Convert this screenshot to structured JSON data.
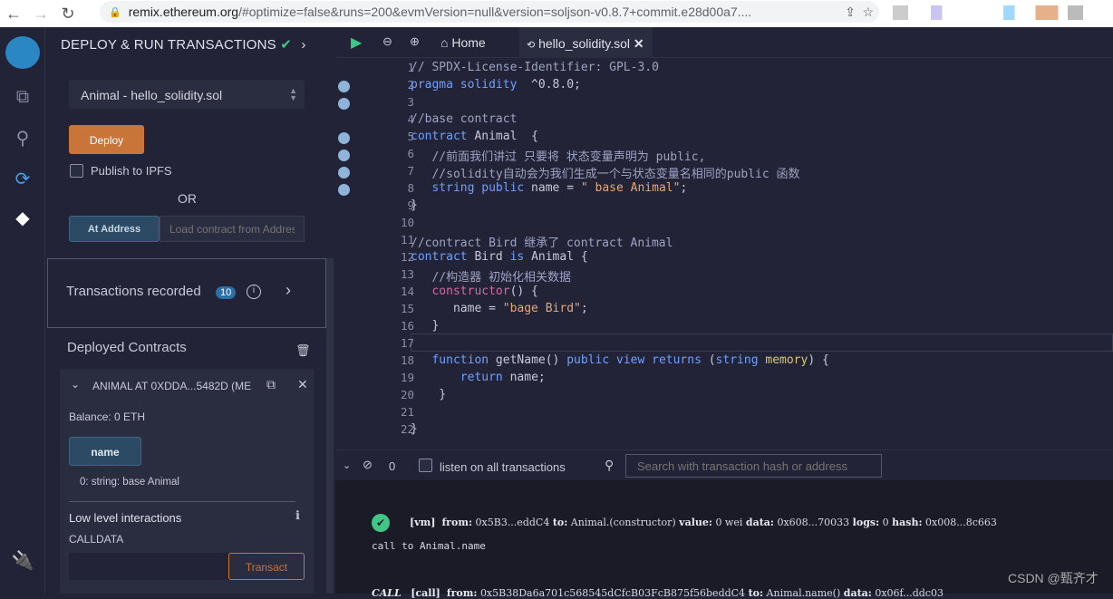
{
  "browser": {
    "url_domain": "remix.ethereum.org",
    "url_rest": "/#optimize=false&runs=200&evmVersion=null&version=soljson-v0.8.7+commit.e28d00a7...."
  },
  "panel": {
    "title": "DEPLOY & RUN TRANSACTIONS",
    "contract_select": "Animal - hello_solidity.sol",
    "deploy": "Deploy",
    "publish_ipfs": "Publish to IPFS",
    "or": "OR",
    "at_address": "At Address",
    "at_address_placeholder": "Load contract from Address",
    "transactions_recorded": "Transactions recorded",
    "tx_count": "10",
    "deployed_contracts": "Deployed Contracts",
    "instance_title": "ANIMAL AT 0XDDA...5482D (ME",
    "balance": "Balance: 0 ETH",
    "name_button": "name",
    "name_result": "0: string: base Animal",
    "low_level": "Low level interactions",
    "calldata": "CALLDATA",
    "transact": "Transact"
  },
  "editor": {
    "tabs": {
      "home": "Home",
      "file": "hello_solidity.sol"
    },
    "lines": [
      [
        [
          "cm",
          "// SPDX-License-Identifier: GPL-3.0"
        ]
      ],
      [
        [
          "kw",
          "pragma solidity"
        ],
        [
          "",
          "  ^0.8.0;"
        ]
      ],
      [],
      [
        [
          "cm",
          "//base contract"
        ]
      ],
      [
        [
          "kw",
          "contract"
        ],
        [
          "",
          " Animal  {"
        ]
      ],
      [
        [
          "cm",
          "   //前面我们讲过 只要将 状态变量声明为 public,"
        ]
      ],
      [
        [
          "cm",
          "   //solidity自动会为我们生成一个与状态变量名相同的public 函数"
        ]
      ],
      [
        [
          "",
          "   "
        ],
        [
          "ty",
          "string public"
        ],
        [
          "",
          " name = "
        ],
        [
          "st",
          "\" base Animal\""
        ],
        [
          "",
          ";"
        ]
      ],
      [
        [
          "",
          "}"
        ]
      ],
      [],
      [
        [
          "cm",
          "//contract Bird 继承了 contract Animal"
        ]
      ],
      [
        [
          "kw",
          "contract"
        ],
        [
          "",
          " Bird "
        ],
        [
          "kw",
          "is"
        ],
        [
          "",
          " Animal {"
        ]
      ],
      [
        [
          "cm",
          "   //构造器 初始化相关数据"
        ]
      ],
      [
        [
          "",
          "   "
        ],
        [
          "bi",
          "constructor"
        ],
        [
          "",
          "() {"
        ]
      ],
      [
        [
          "",
          "      name = "
        ],
        [
          "st",
          "\"bage Bird\""
        ],
        [
          "",
          ";"
        ]
      ],
      [
        [
          "",
          "   }"
        ]
      ],
      [],
      [
        [
          "",
          "   "
        ],
        [
          "kw",
          "function"
        ],
        [
          "",
          " getName() "
        ],
        [
          "kw",
          "public view returns"
        ],
        [
          "",
          " ("
        ],
        [
          "ty",
          "string"
        ],
        [
          "",
          " "
        ],
        [
          "fn",
          "memory"
        ],
        [
          "",
          ") {"
        ]
      ],
      [
        [
          "",
          "       "
        ],
        [
          "kw",
          "return"
        ],
        [
          "",
          " name;"
        ]
      ],
      [
        [
          "",
          "    }"
        ]
      ],
      [],
      [
        [
          "",
          "}"
        ]
      ]
    ],
    "breakpoint_lines": [
      2,
      3,
      5,
      6,
      7,
      8
    ]
  },
  "terminal": {
    "count": "0",
    "listen": "listen on all transactions",
    "search_placeholder": "Search with transaction hash or address",
    "log1": {
      "tag": "[vm]",
      "from_label": "from:",
      "from": "0x5B3...eddC4",
      "to_label": "to:",
      "to": "Animal.(constructor)",
      "value_label": "value:",
      "value": "0 wei",
      "data_label": "data:",
      "data": "0x608...70033",
      "logs_label": "logs:",
      "logs": "0",
      "hash_label": "hash:",
      "hash": "0x008...8c663"
    },
    "log2": "call to Animal.name",
    "log3": {
      "call": "CALL",
      "tag": "[call]",
      "from_label": "from:",
      "from": "0x5B38Da6a701c568545dCfcB03FcB875f56beddC4",
      "to_label": "to:",
      "to": "Animal.name()",
      "data_label": "data:",
      "data": "0x06f...ddc03"
    }
  },
  "watermark": "CSDN @甄齐才"
}
